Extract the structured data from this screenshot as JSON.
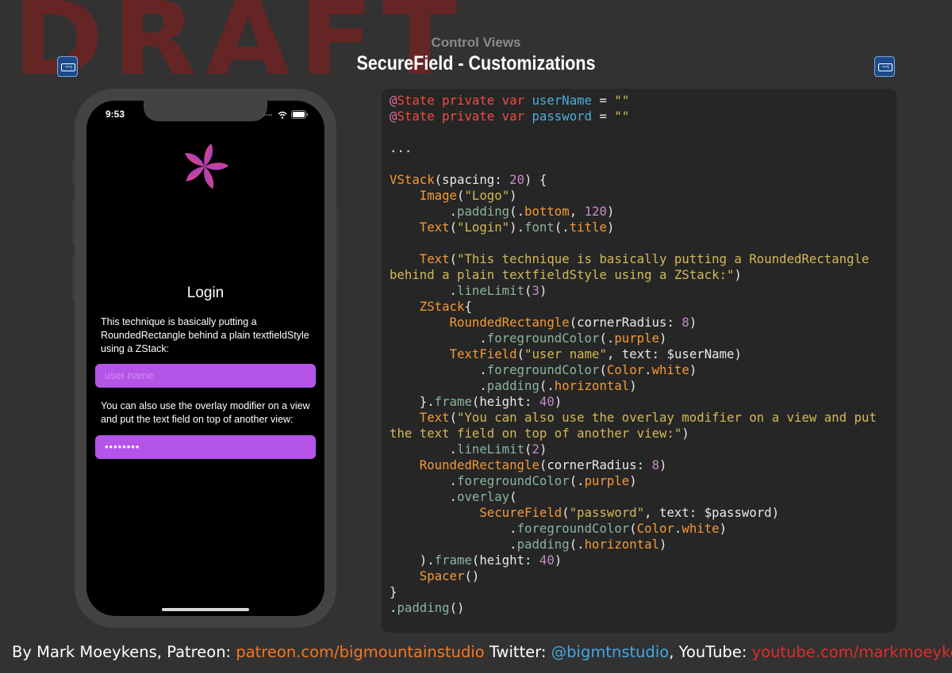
{
  "watermark": "DRAFT",
  "header": {
    "section": "Control Views",
    "title": "SecureField - Customizations"
  },
  "icons": {
    "left": "securefield-icon",
    "right": "securefield-icon",
    "field_dots": "•••|"
  },
  "phone": {
    "status_time": "9:53",
    "login_title": "Login",
    "text1": "This technique is basically putting a RoundedRectangle behind a plain textfieldStyle using a ZStack:",
    "username_placeholder": "user name",
    "text2": "You can also use the overlay modifier on a view and put the text field on top of another view:",
    "password_value": "••••••••"
  },
  "colors": {
    "field": "#b455e8",
    "keyword": "#f24b3f",
    "attribute": "#e0709d",
    "identifier": "#49b0dc",
    "string": "#d3b955",
    "number": "#c48bc7",
    "modifier": "#8bb59c",
    "type": "#f59a36"
  },
  "code": [
    [
      [
        "purple",
        "@"
      ],
      [
        "kw",
        "State private var "
      ],
      [
        "blue",
        "userName"
      ],
      [
        "pl",
        " = "
      ],
      [
        "str",
        "\"\""
      ]
    ],
    [
      [
        "purple",
        "@"
      ],
      [
        "kw",
        "State private var "
      ],
      [
        "blue",
        "password"
      ],
      [
        "pl",
        " = "
      ],
      [
        "str",
        "\"\""
      ]
    ],
    [],
    [
      [
        "pl",
        "..."
      ]
    ],
    [],
    [
      [
        "type",
        "VStack"
      ],
      [
        "pl",
        "(spacing: "
      ],
      [
        "num",
        "20"
      ],
      [
        "pl",
        ") {"
      ]
    ],
    [
      [
        "pl",
        "    "
      ],
      [
        "type",
        "Image"
      ],
      [
        "pl",
        "("
      ],
      [
        "str",
        "\"Logo\""
      ],
      [
        "pl",
        ")"
      ]
    ],
    [
      [
        "pl",
        "        ."
      ],
      [
        "mod",
        "padding"
      ],
      [
        "pl",
        "(."
      ],
      [
        "type",
        "bottom"
      ],
      [
        "pl",
        ", "
      ],
      [
        "num",
        "120"
      ],
      [
        "pl",
        ")"
      ]
    ],
    [
      [
        "pl",
        "    "
      ],
      [
        "type",
        "Text"
      ],
      [
        "pl",
        "("
      ],
      [
        "str",
        "\"Login\""
      ],
      [
        "pl",
        ")."
      ],
      [
        "mod",
        "font"
      ],
      [
        "pl",
        "(."
      ],
      [
        "type",
        "title"
      ],
      [
        "pl",
        ")"
      ]
    ],
    [],
    [
      [
        "pl",
        "    "
      ],
      [
        "type",
        "Text"
      ],
      [
        "pl",
        "("
      ],
      [
        "str",
        "\"This technique is basically putting a RoundedRectangle"
      ]
    ],
    [
      [
        "str",
        "behind a plain textfieldStyle using a ZStack:\""
      ],
      [
        "pl",
        ")"
      ]
    ],
    [
      [
        "pl",
        "        ."
      ],
      [
        "mod",
        "lineLimit"
      ],
      [
        "pl",
        "("
      ],
      [
        "num",
        "3"
      ],
      [
        "pl",
        ")"
      ]
    ],
    [
      [
        "pl",
        "    "
      ],
      [
        "type",
        "ZStack"
      ],
      [
        "pl",
        "{"
      ]
    ],
    [
      [
        "pl",
        "        "
      ],
      [
        "type",
        "RoundedRectangle"
      ],
      [
        "pl",
        "(cornerRadius: "
      ],
      [
        "num",
        "8"
      ],
      [
        "pl",
        ")"
      ]
    ],
    [
      [
        "pl",
        "            ."
      ],
      [
        "mod",
        "foregroundColor"
      ],
      [
        "pl",
        "(."
      ],
      [
        "type",
        "purple"
      ],
      [
        "pl",
        ")"
      ]
    ],
    [
      [
        "pl",
        "        "
      ],
      [
        "type",
        "TextField"
      ],
      [
        "pl",
        "("
      ],
      [
        "str",
        "\"user name\""
      ],
      [
        "pl",
        ", text: $userName)"
      ]
    ],
    [
      [
        "pl",
        "            ."
      ],
      [
        "mod",
        "foregroundColor"
      ],
      [
        "pl",
        "("
      ],
      [
        "type",
        "Color"
      ],
      [
        "pl",
        "."
      ],
      [
        "type",
        "white"
      ],
      [
        "pl",
        ")"
      ]
    ],
    [
      [
        "pl",
        "            ."
      ],
      [
        "mod",
        "padding"
      ],
      [
        "pl",
        "(."
      ],
      [
        "type",
        "horizontal"
      ],
      [
        "pl",
        ")"
      ]
    ],
    [
      [
        "pl",
        "    }."
      ],
      [
        "mod",
        "frame"
      ],
      [
        "pl",
        "(height: "
      ],
      [
        "num",
        "40"
      ],
      [
        "pl",
        ")"
      ]
    ],
    [
      [
        "pl",
        "    "
      ],
      [
        "type",
        "Text"
      ],
      [
        "pl",
        "("
      ],
      [
        "str",
        "\"You can also use the overlay modifier on a view and put"
      ]
    ],
    [
      [
        "str",
        "the text field on top of another view:\""
      ],
      [
        "pl",
        ")"
      ]
    ],
    [
      [
        "pl",
        "        ."
      ],
      [
        "mod",
        "lineLimit"
      ],
      [
        "pl",
        "("
      ],
      [
        "num",
        "2"
      ],
      [
        "pl",
        ")"
      ]
    ],
    [
      [
        "pl",
        "    "
      ],
      [
        "type",
        "RoundedRectangle"
      ],
      [
        "pl",
        "(cornerRadius: "
      ],
      [
        "num",
        "8"
      ],
      [
        "pl",
        ")"
      ]
    ],
    [
      [
        "pl",
        "        ."
      ],
      [
        "mod",
        "foregroundColor"
      ],
      [
        "pl",
        "(."
      ],
      [
        "type",
        "purple"
      ],
      [
        "pl",
        ")"
      ]
    ],
    [
      [
        "pl",
        "        ."
      ],
      [
        "mod",
        "overlay"
      ],
      [
        "pl",
        "("
      ]
    ],
    [
      [
        "pl",
        "            "
      ],
      [
        "type",
        "SecureField"
      ],
      [
        "pl",
        "("
      ],
      [
        "str",
        "\"password\""
      ],
      [
        "pl",
        ", text: $password)"
      ]
    ],
    [
      [
        "pl",
        "                ."
      ],
      [
        "mod",
        "foregroundColor"
      ],
      [
        "pl",
        "("
      ],
      [
        "type",
        "Color"
      ],
      [
        "pl",
        "."
      ],
      [
        "type",
        "white"
      ],
      [
        "pl",
        ")"
      ]
    ],
    [
      [
        "pl",
        "                ."
      ],
      [
        "mod",
        "padding"
      ],
      [
        "pl",
        "(."
      ],
      [
        "type",
        "horizontal"
      ],
      [
        "pl",
        ")"
      ]
    ],
    [
      [
        "pl",
        "    )."
      ],
      [
        "mod",
        "frame"
      ],
      [
        "pl",
        "(height: "
      ],
      [
        "num",
        "40"
      ],
      [
        "pl",
        ")"
      ]
    ],
    [
      [
        "pl",
        "    "
      ],
      [
        "type",
        "Spacer"
      ],
      [
        "pl",
        "()"
      ]
    ],
    [
      [
        "pl",
        "}"
      ]
    ],
    [
      [
        "pl",
        "."
      ],
      [
        "mod",
        "padding"
      ],
      [
        "pl",
        "()"
      ]
    ]
  ],
  "footer": {
    "prefix": "By Mark Moeykens, Patreon: ",
    "patreon": "patreon.com/bigmountainstudio",
    "twitter_label": " Twitter: ",
    "twitter": "@bigmtnstudio",
    "youtube_label": ", YouTube: ",
    "youtube": "youtube.com/markmoeykens"
  }
}
